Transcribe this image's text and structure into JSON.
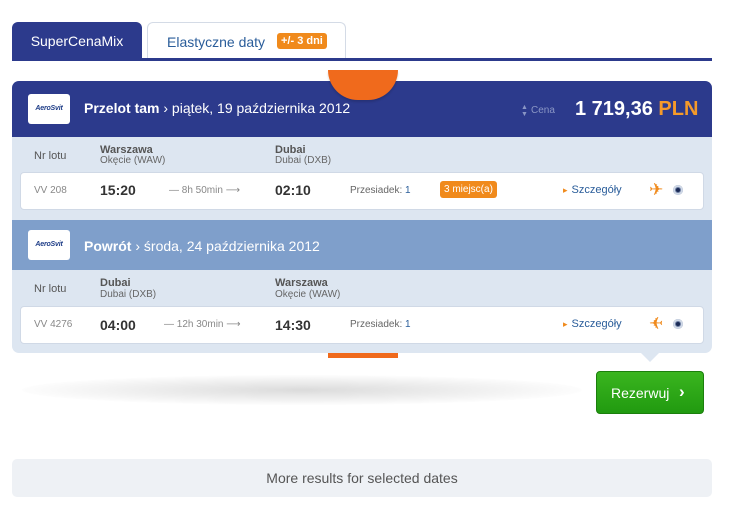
{
  "tabs": [
    {
      "label": "SuperCenaMix"
    },
    {
      "label": "Elastyczne daty",
      "badge": "+/- 3 dni"
    }
  ],
  "outbound": {
    "direction": "Przelot tam",
    "date": "piątek, 19 października 2012",
    "airline_logo": "AeroSvit",
    "price_label": "Cena",
    "price": "1 719,36",
    "currency": "PLN",
    "col_label": "Nr lotu",
    "from_city": "Warszawa",
    "from_airport": "Okęcie (WAW)",
    "to_city": "Dubai",
    "to_airport": "Dubai (DXB)",
    "flight_no": "VV 208",
    "dep_time": "15:20",
    "duration": "8h 50min",
    "arr_time": "02:10",
    "stops_label": "Przesiadek:",
    "stops": "1",
    "seats": "3 miejsc(a)",
    "details": "Szczegóły"
  },
  "return": {
    "direction": "Powrót",
    "date": "środa, 24 października 2012",
    "airline_logo": "AeroSvit",
    "col_label": "Nr lotu",
    "from_city": "Dubai",
    "from_airport": "Dubai (DXB)",
    "to_city": "Warszawa",
    "to_airport": "Okęcie (WAW)",
    "flight_no": "VV 4276",
    "dep_time": "04:00",
    "duration": "12h 30min",
    "arr_time": "14:30",
    "stops_label": "Przesiadek:",
    "stops": "1",
    "details": "Szczegóły"
  },
  "book_button": {
    "label": "Rezerwuj",
    "icon": "chevron-right-icon"
  },
  "more_results": "More results for selected dates",
  "colors": {
    "primary": "#2c3a8c",
    "accent": "#f08a1c",
    "secondary_header": "#7f9fcb",
    "book": "#2ba616"
  }
}
